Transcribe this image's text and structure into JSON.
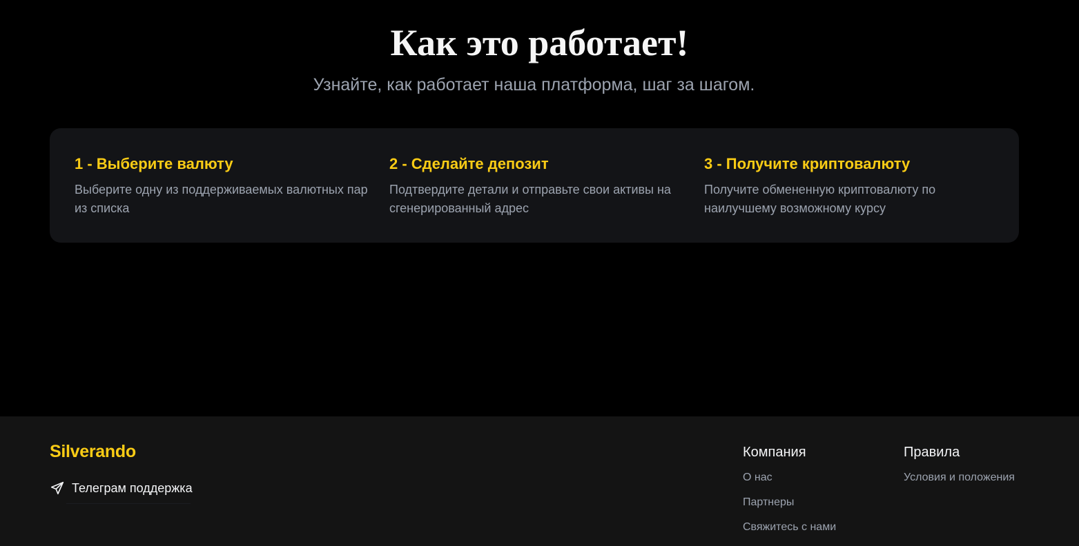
{
  "hero": {
    "title": "Как это работает!",
    "subtitle": "Узнайте, как работает наша платформа, шаг за шагом."
  },
  "steps": [
    {
      "title": "1 - Выберите валюту",
      "description": "Выберите одну из поддерживаемых валютных пар из списка"
    },
    {
      "title": "2 - Сделайте депозит",
      "description": "Подтвердите детали и отправьте свои активы на сгенерированный адрес"
    },
    {
      "title": "3 - Получите криптовалюту",
      "description": "Получите обмененную криптовалюту по наилучшему возможному курсу"
    }
  ],
  "footer": {
    "brand": "Silverando",
    "telegram_label": "Телеграм поддержка",
    "telegram_icon": "send-icon",
    "company": {
      "title": "Компания",
      "links": [
        "О нас",
        "Партнеры",
        "Свяжитесь с нами"
      ]
    },
    "rules": {
      "title": "Правила",
      "links": [
        "Условия и положения"
      ]
    }
  },
  "colors": {
    "accent": "#facc15",
    "background": "#000000",
    "card": "#131417",
    "footer": "#141414",
    "muted_text": "#9ca3af"
  }
}
